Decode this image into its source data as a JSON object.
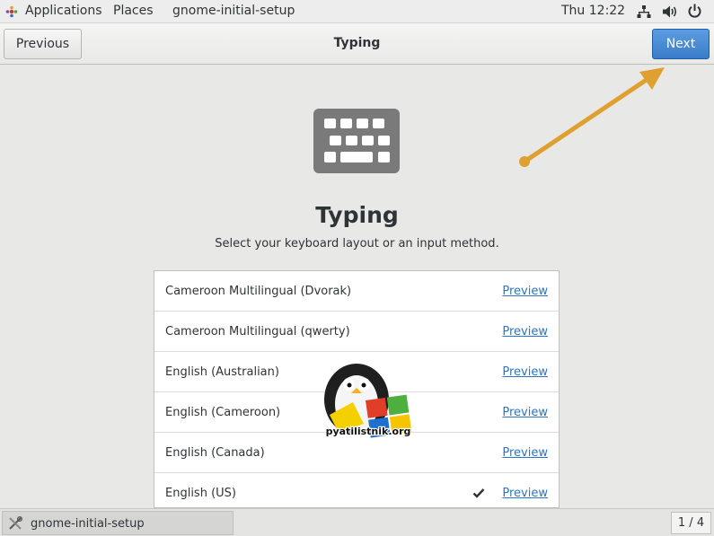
{
  "top_panel": {
    "applications": "Applications",
    "places": "Places",
    "app_name": "gnome-initial-setup",
    "clock": "Thu 12:22",
    "icons": [
      "applications-icon",
      "network-icon",
      "volume-icon",
      "power-icon"
    ]
  },
  "header": {
    "previous_label": "Previous",
    "title": "Typing",
    "next_label": "Next"
  },
  "main": {
    "icon": "keyboard-icon",
    "heading": "Typing",
    "subtitle": "Select your keyboard layout or an input method.",
    "layouts": [
      {
        "name": "Cameroon Multilingual (Dvorak)",
        "preview": "Preview",
        "selected": false
      },
      {
        "name": "Cameroon Multilingual (qwerty)",
        "preview": "Preview",
        "selected": false
      },
      {
        "name": "English (Australian)",
        "preview": "Preview",
        "selected": false
      },
      {
        "name": "English (Cameroon)",
        "preview": "Preview",
        "selected": false
      },
      {
        "name": "English (Canada)",
        "preview": "Preview",
        "selected": false
      },
      {
        "name": "English (US)",
        "preview": "Preview",
        "selected": true
      }
    ]
  },
  "watermark": {
    "text": "pyatilistnik.org"
  },
  "bottom_bar": {
    "task_label": "gnome-initial-setup",
    "workspace": "1 / 4"
  },
  "colors": {
    "accent": "#3a7cc9",
    "link": "#2a76c6",
    "arrow": "#e0a030",
    "icon_gray": "#7a7a7a"
  }
}
